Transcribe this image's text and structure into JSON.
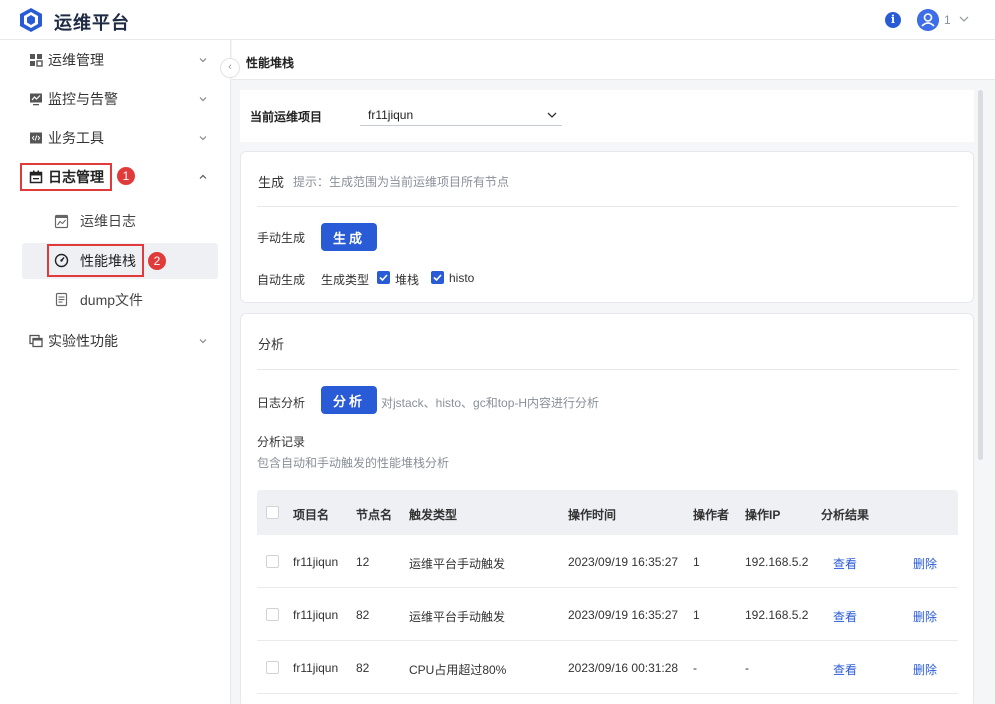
{
  "app": {
    "title": "运维平台"
  },
  "header": {
    "user_name": "1"
  },
  "sidebar": {
    "items": [
      {
        "label": "运维管理"
      },
      {
        "label": "监控与告警"
      },
      {
        "label": "业务工具"
      },
      {
        "label": "日志管理"
      },
      {
        "label": "实验性功能"
      }
    ],
    "log_sub_items": [
      {
        "label": "运维日志"
      },
      {
        "label": "性能堆栈"
      },
      {
        "label": "dump文件"
      }
    ],
    "annotations": [
      "1",
      "2"
    ]
  },
  "breadcrumb": "性能堆栈",
  "project": {
    "label": "当前运维项目",
    "value": "fr11jiqun"
  },
  "generate": {
    "title": "生成",
    "hint": "提示：生成范围为当前运维项目所有节点",
    "manual_label": "手动生成",
    "button": "生成",
    "auto_label": "自动生成",
    "type_label": "生成类型",
    "options": [
      "堆栈",
      "histo"
    ]
  },
  "analysis": {
    "title": "分析",
    "log_label": "日志分析",
    "button": "分析",
    "button_hint": "对jstack、histo、gc和top-H内容进行分析",
    "records_title": "分析记录",
    "records_desc": "包含自动和手动触发的性能堆栈分析"
  },
  "table": {
    "columns": [
      "项目名",
      "节点名",
      "触发类型",
      "操作时间",
      "操作者",
      "操作IP",
      "分析结果"
    ],
    "rows": [
      {
        "project": "fr11jiqun",
        "node": "12",
        "trigger": "运维平台手动触发",
        "time": "2023/09/19 16:35:27",
        "operator": "1",
        "ip": "192.168.5.2",
        "view": "查看",
        "delete": "删除"
      },
      {
        "project": "fr11jiqun",
        "node": "82",
        "trigger": "运维平台手动触发",
        "time": "2023/09/19 16:35:27",
        "operator": "1",
        "ip": "192.168.5.2",
        "view": "查看",
        "delete": "删除"
      },
      {
        "project": "fr11jiqun",
        "node": "82",
        "trigger": "CPU占用超过80%",
        "time": "2023/09/16 00:31:28",
        "operator": "-",
        "ip": "-",
        "view": "查看",
        "delete": "删除"
      }
    ]
  },
  "colors": {
    "primary": "#2a5bd7",
    "annotation": "#e03a3a"
  }
}
